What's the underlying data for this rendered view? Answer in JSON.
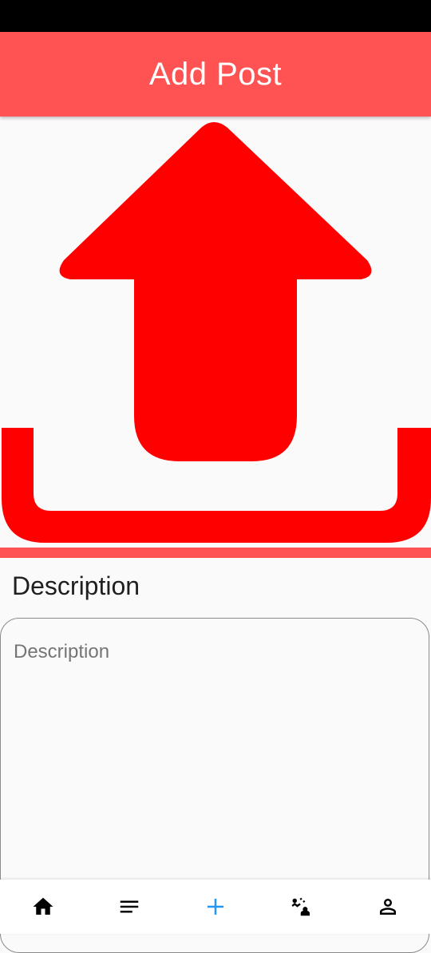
{
  "app_bar": {
    "title": "Add Post",
    "background": "#ff5252",
    "title_color": "#ffffff"
  },
  "upload": {
    "icon": "upload-icon",
    "icon_color": "#ff0000"
  },
  "description": {
    "label": "Description",
    "placeholder": "Description",
    "value": ""
  },
  "bottom_nav": {
    "items": [
      {
        "icon": "home-icon",
        "active": false
      },
      {
        "icon": "feed-list-icon",
        "active": false
      },
      {
        "icon": "add-icon",
        "active": true
      },
      {
        "icon": "connections-icon",
        "active": false
      },
      {
        "icon": "profile-icon",
        "active": false
      }
    ],
    "active_color": "#2196f3",
    "inactive_color": "#000000"
  }
}
